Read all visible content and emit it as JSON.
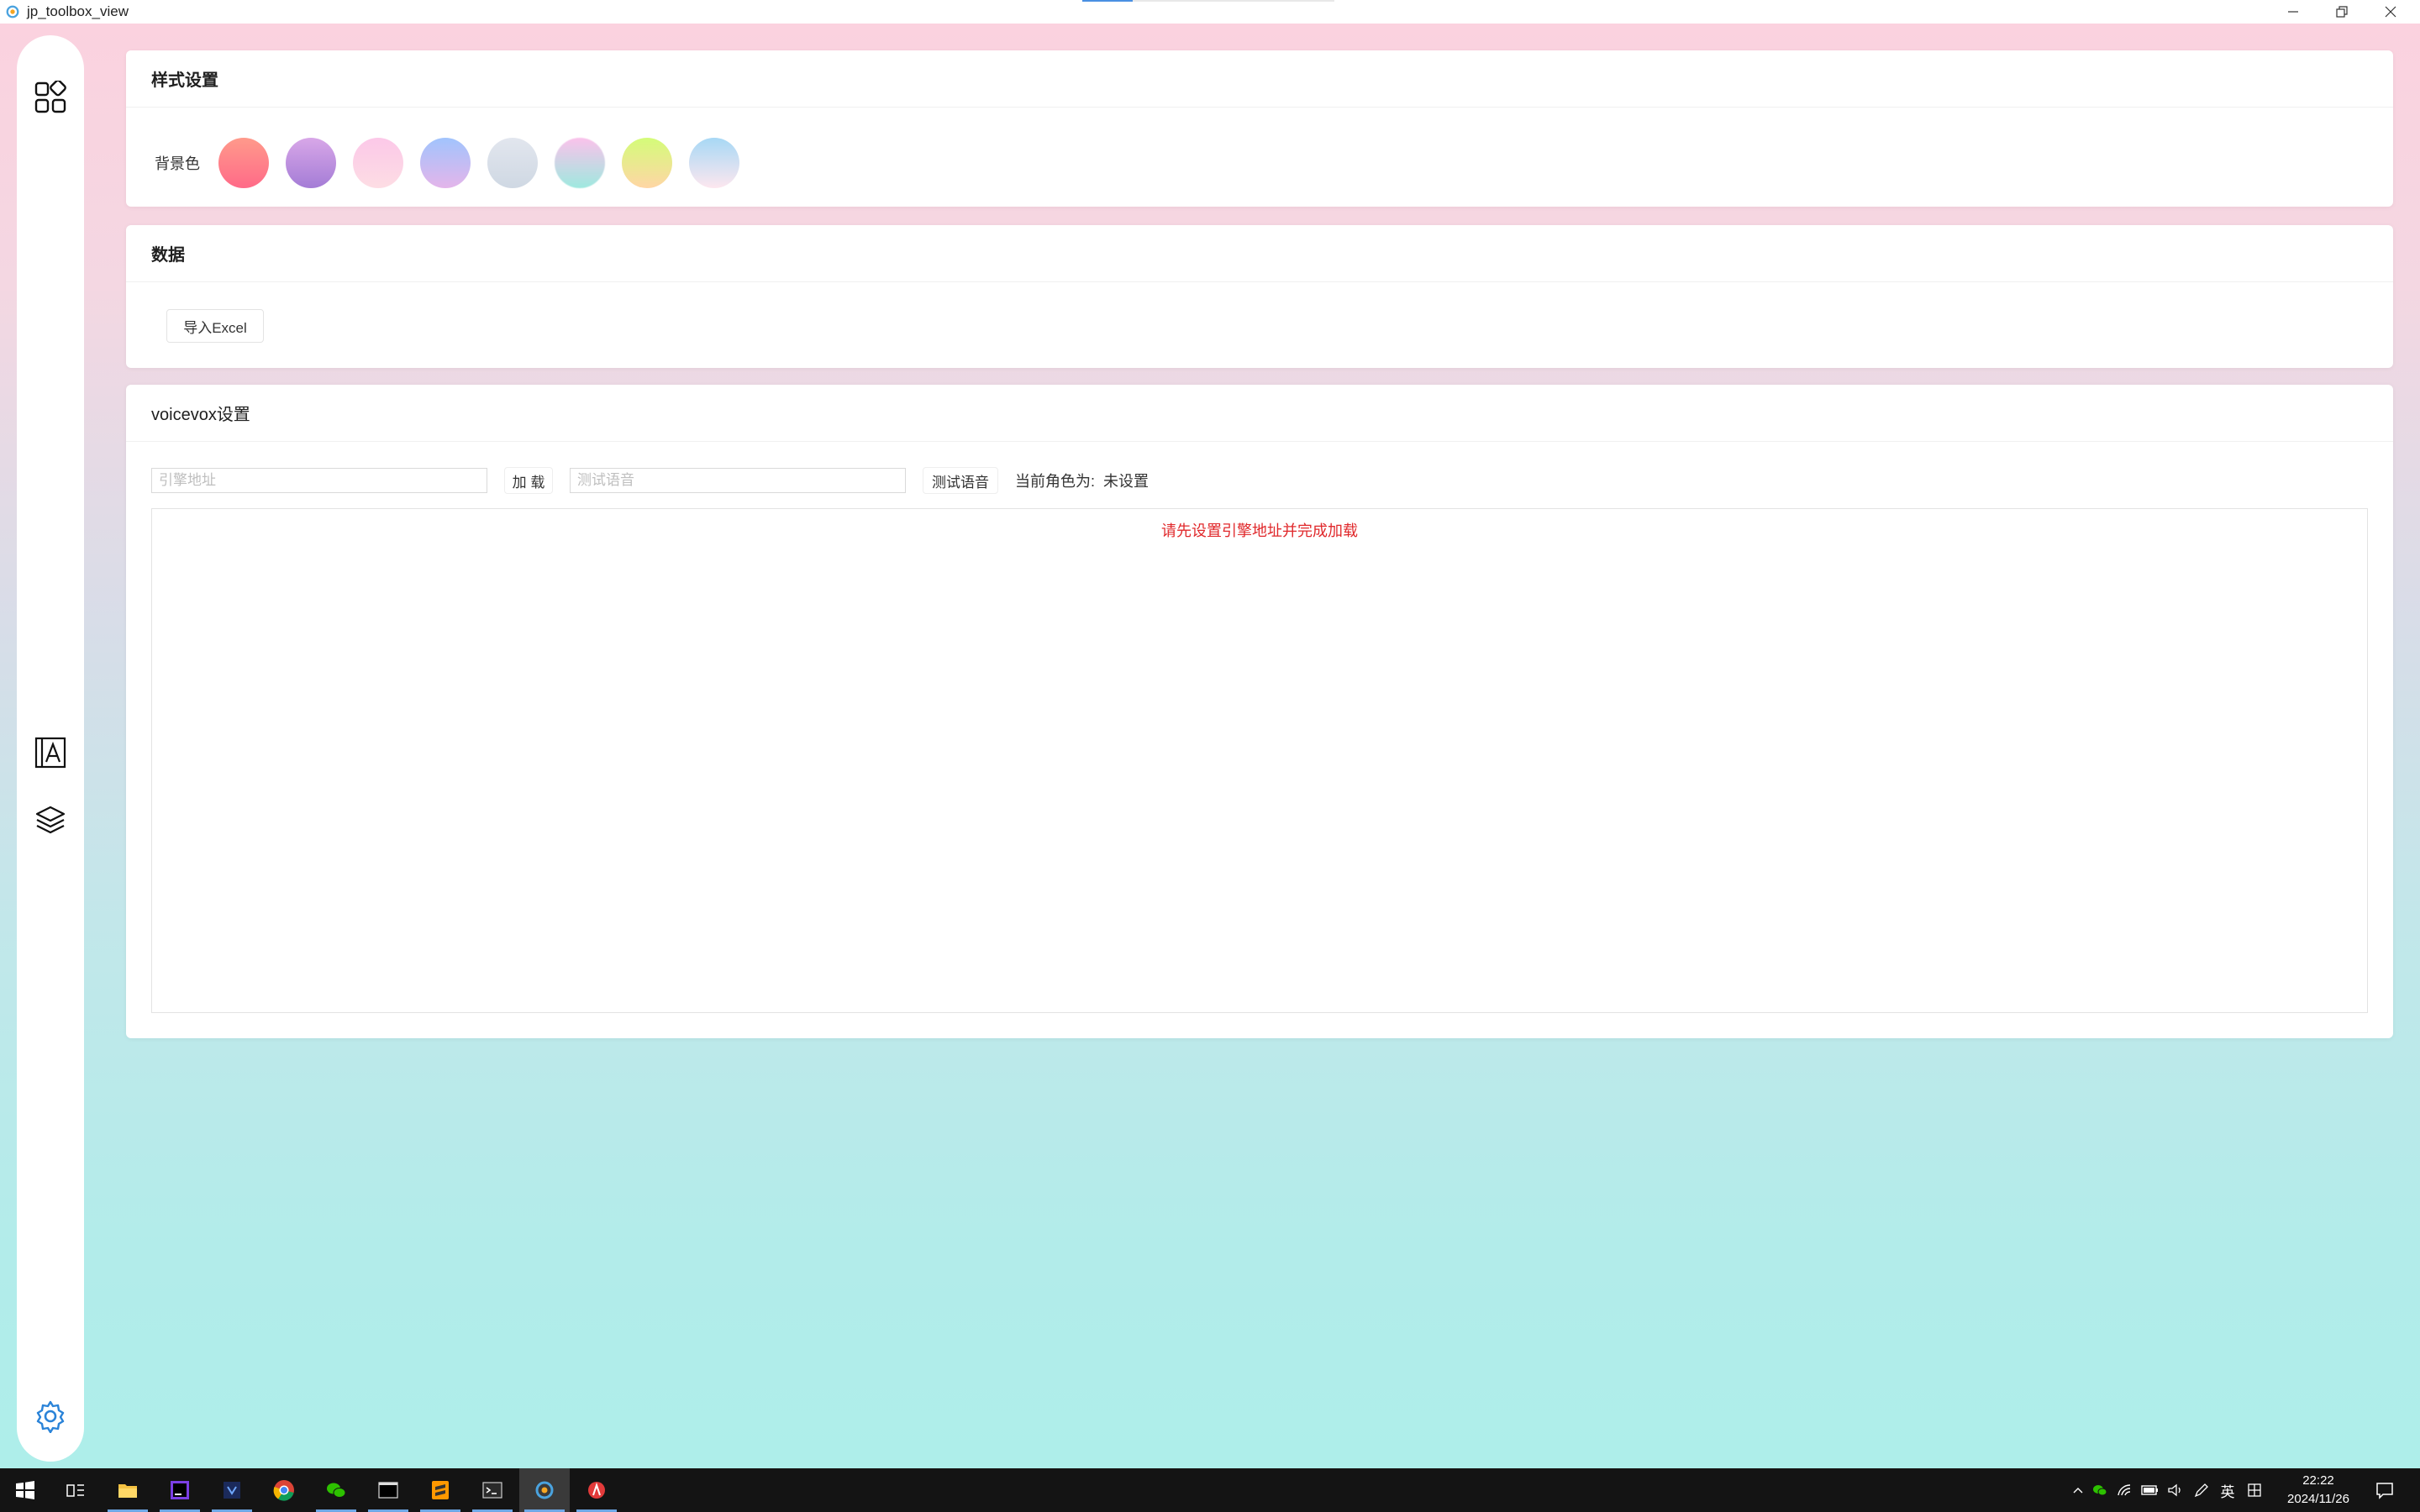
{
  "window": {
    "title": "jp_toolbox_view"
  },
  "sidebar": {
    "items": [
      {
        "icon": "dashboard-icon"
      },
      {
        "icon": "font-icon"
      },
      {
        "icon": "layers-icon"
      },
      {
        "icon": "settings-icon"
      }
    ]
  },
  "style_card": {
    "title": "样式设置",
    "bg_label": "背景色",
    "swatches": [
      {
        "from": "#ff9a8b",
        "to": "#ff6a88"
      },
      {
        "from": "#d8a7e8",
        "to": "#a47cd6"
      },
      {
        "from": "#fcc8e8",
        "to": "#fddde4"
      },
      {
        "from": "#a1c4fd",
        "to": "#e4b5ea"
      },
      {
        "from": "#e2e6ee",
        "to": "#cfd8e3"
      },
      {
        "from": "#fbc2eb",
        "to": "#9ee9df"
      },
      {
        "from": "#d4fc79",
        "to": "#ffd6a5"
      },
      {
        "from": "#a7d8f5",
        "to": "#fde7ef"
      }
    ]
  },
  "data_card": {
    "title": "数据",
    "import_button": "导入Excel"
  },
  "voicevox_card": {
    "title": "voicevox设置",
    "engine_placeholder": "引擎地址",
    "load_button": "加 载",
    "test_placeholder": "测试语音",
    "test_button": "测试语音",
    "role_label": "当前角色为:",
    "role_value": "未设置",
    "message": "请先设置引擎地址并完成加载"
  },
  "taskbar": {
    "apps": [
      "start-icon",
      "task-view-icon",
      "file-explorer-icon",
      "jetbrains-icon",
      "visual-studio-icon",
      "chrome-icon",
      "wechat-icon",
      "terminal-icon",
      "sublime-icon",
      "powershell-icon",
      "app-icon",
      "toolbox-icon"
    ],
    "ime": "英",
    "time": "22:22",
    "date": "2024/11/26"
  }
}
